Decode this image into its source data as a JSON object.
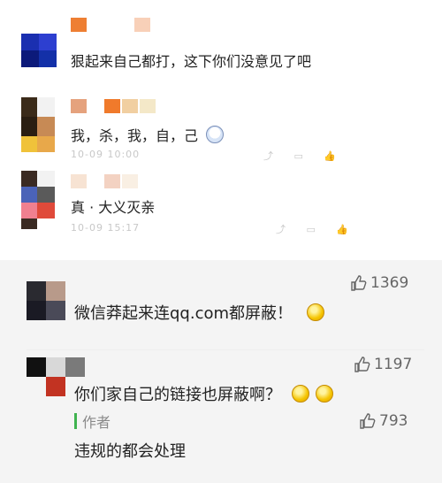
{
  "top_comments": [
    {
      "text": "狠起来自己都打，这下你们没意见了吧",
      "meta": "",
      "avatar_colors": [
        "#1a2fb0",
        "#2d3fd0",
        "#0c1a7a",
        "#1330a8"
      ],
      "name_colors": [
        "#ee7f33",
        "#f8d0b8"
      ]
    },
    {
      "text": "我，杀，我，自，己",
      "meta": "10-09 10:00",
      "avatar_colors": [
        "#3b2b1a",
        "#c78a55",
        "#f0c23a",
        "#2a1e12"
      ],
      "name_colors": [
        "#e5a27d",
        "#f07a2b",
        "#f1cfa1",
        "#f4e8c8"
      ]
    },
    {
      "text": "真 · 大义灭亲",
      "meta": "10-09 15:17",
      "avatar_colors": [
        "#3a2a22",
        "#4b63b8",
        "#f08090",
        "#e04a3a",
        "#5a5a5a"
      ],
      "name_colors": [
        "#f7e3d3",
        "#f3d2c2",
        "#f9efe3"
      ]
    }
  ],
  "bottom_comments": [
    {
      "text": "微信莽起来连qq.com都屏蔽！",
      "likes": "1369",
      "avatar_colors": [
        "#2a2a30",
        "#b89a8a",
        "#1a1a24",
        "#4a4a58"
      ]
    },
    {
      "text": "你们家自己的链接也屏蔽啊？",
      "likes": "1197",
      "avatar_colors": [
        "#111111",
        "#d8d8d8",
        "#7a7a7a",
        "#c23322"
      ]
    }
  ],
  "reply": {
    "author_label": "作者",
    "text": "违规的都会处理",
    "likes": "793"
  },
  "colors": {
    "panel_bg": "#f4f4f4",
    "accent_green": "#3fb34f"
  }
}
